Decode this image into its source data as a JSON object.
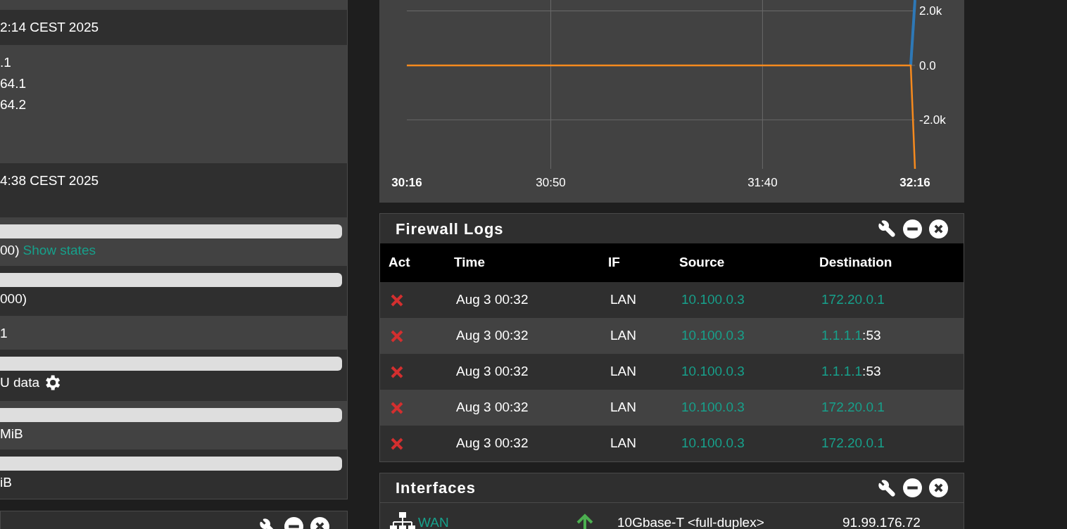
{
  "left_panel": {
    "rows": [
      {
        "kind": "blank"
      },
      {
        "kind": "text",
        "lines": [
          "2:14 CEST 2025"
        ]
      },
      {
        "kind": "text",
        "lines": [
          ".1",
          "64.1",
          "64.2"
        ]
      },
      {
        "kind": "text",
        "lines": [
          "4:38 CEST 2025"
        ]
      },
      {
        "kind": "bar",
        "level": 0,
        "text": "00)",
        "link": "Show states"
      },
      {
        "kind": "bar",
        "level": 0,
        "text": "000)"
      },
      {
        "kind": "text",
        "lines": [
          "1"
        ]
      },
      {
        "kind": "bar",
        "level": 0,
        "text": "U data",
        "gear": true
      },
      {
        "kind": "bar",
        "level": 0,
        "text": "MiB"
      },
      {
        "kind": "bar",
        "level": 0,
        "text": "iB"
      }
    ]
  },
  "traffic_chart": {
    "chart_data": {
      "type": "line",
      "grid": true,
      "x": [
        1816,
        1935,
        1936
      ],
      "xlim": [
        1816,
        1936
      ],
      "ylim": [
        -3800,
        2400
      ],
      "xticks": [
        {
          "value": 1816,
          "label": "30:16"
        },
        {
          "value": 1850,
          "label": "30:50"
        },
        {
          "value": 1900,
          "label": "31:40"
        },
        {
          "value": 1936,
          "label": "32:16"
        }
      ],
      "yticks": [
        {
          "value": 2000,
          "label": "2.0k"
        },
        {
          "value": 0,
          "label": "0.0"
        },
        {
          "value": -2000,
          "label": "-2.0k"
        }
      ],
      "series": [
        {
          "color": "#2e78b6",
          "values": [
            null,
            0,
            2400
          ]
        },
        {
          "color": "#f68a1e",
          "values": [
            0,
            0,
            -3800
          ]
        }
      ]
    }
  },
  "firewall_logs": {
    "title": "Firewall Logs",
    "columns": [
      "Act",
      "Time",
      "IF",
      "Source",
      "Destination"
    ],
    "rows": [
      {
        "blocked": true,
        "time": "Aug 3 00:32",
        "if": "LAN",
        "source": "10.100.0.3",
        "destination": "172.20.0.1"
      },
      {
        "blocked": true,
        "time": "Aug 3 00:32",
        "if": "LAN",
        "source": "10.100.0.3",
        "destination": "1.1.1.1",
        "port": ":53"
      },
      {
        "blocked": true,
        "time": "Aug 3 00:32",
        "if": "LAN",
        "source": "10.100.0.3",
        "destination": "1.1.1.1",
        "port": ":53"
      },
      {
        "blocked": true,
        "time": "Aug 3 00:32",
        "if": "LAN",
        "source": "10.100.0.3",
        "destination": "172.20.0.1"
      },
      {
        "blocked": true,
        "time": "Aug 3 00:32",
        "if": "LAN",
        "source": "10.100.0.3",
        "destination": "172.20.0.1"
      }
    ]
  },
  "interfaces": {
    "title": "Interfaces",
    "rows": [
      {
        "name": "WAN",
        "up": true,
        "media": "10Gbase-T <full-duplex>",
        "address": "91.99.176.72"
      }
    ]
  }
}
